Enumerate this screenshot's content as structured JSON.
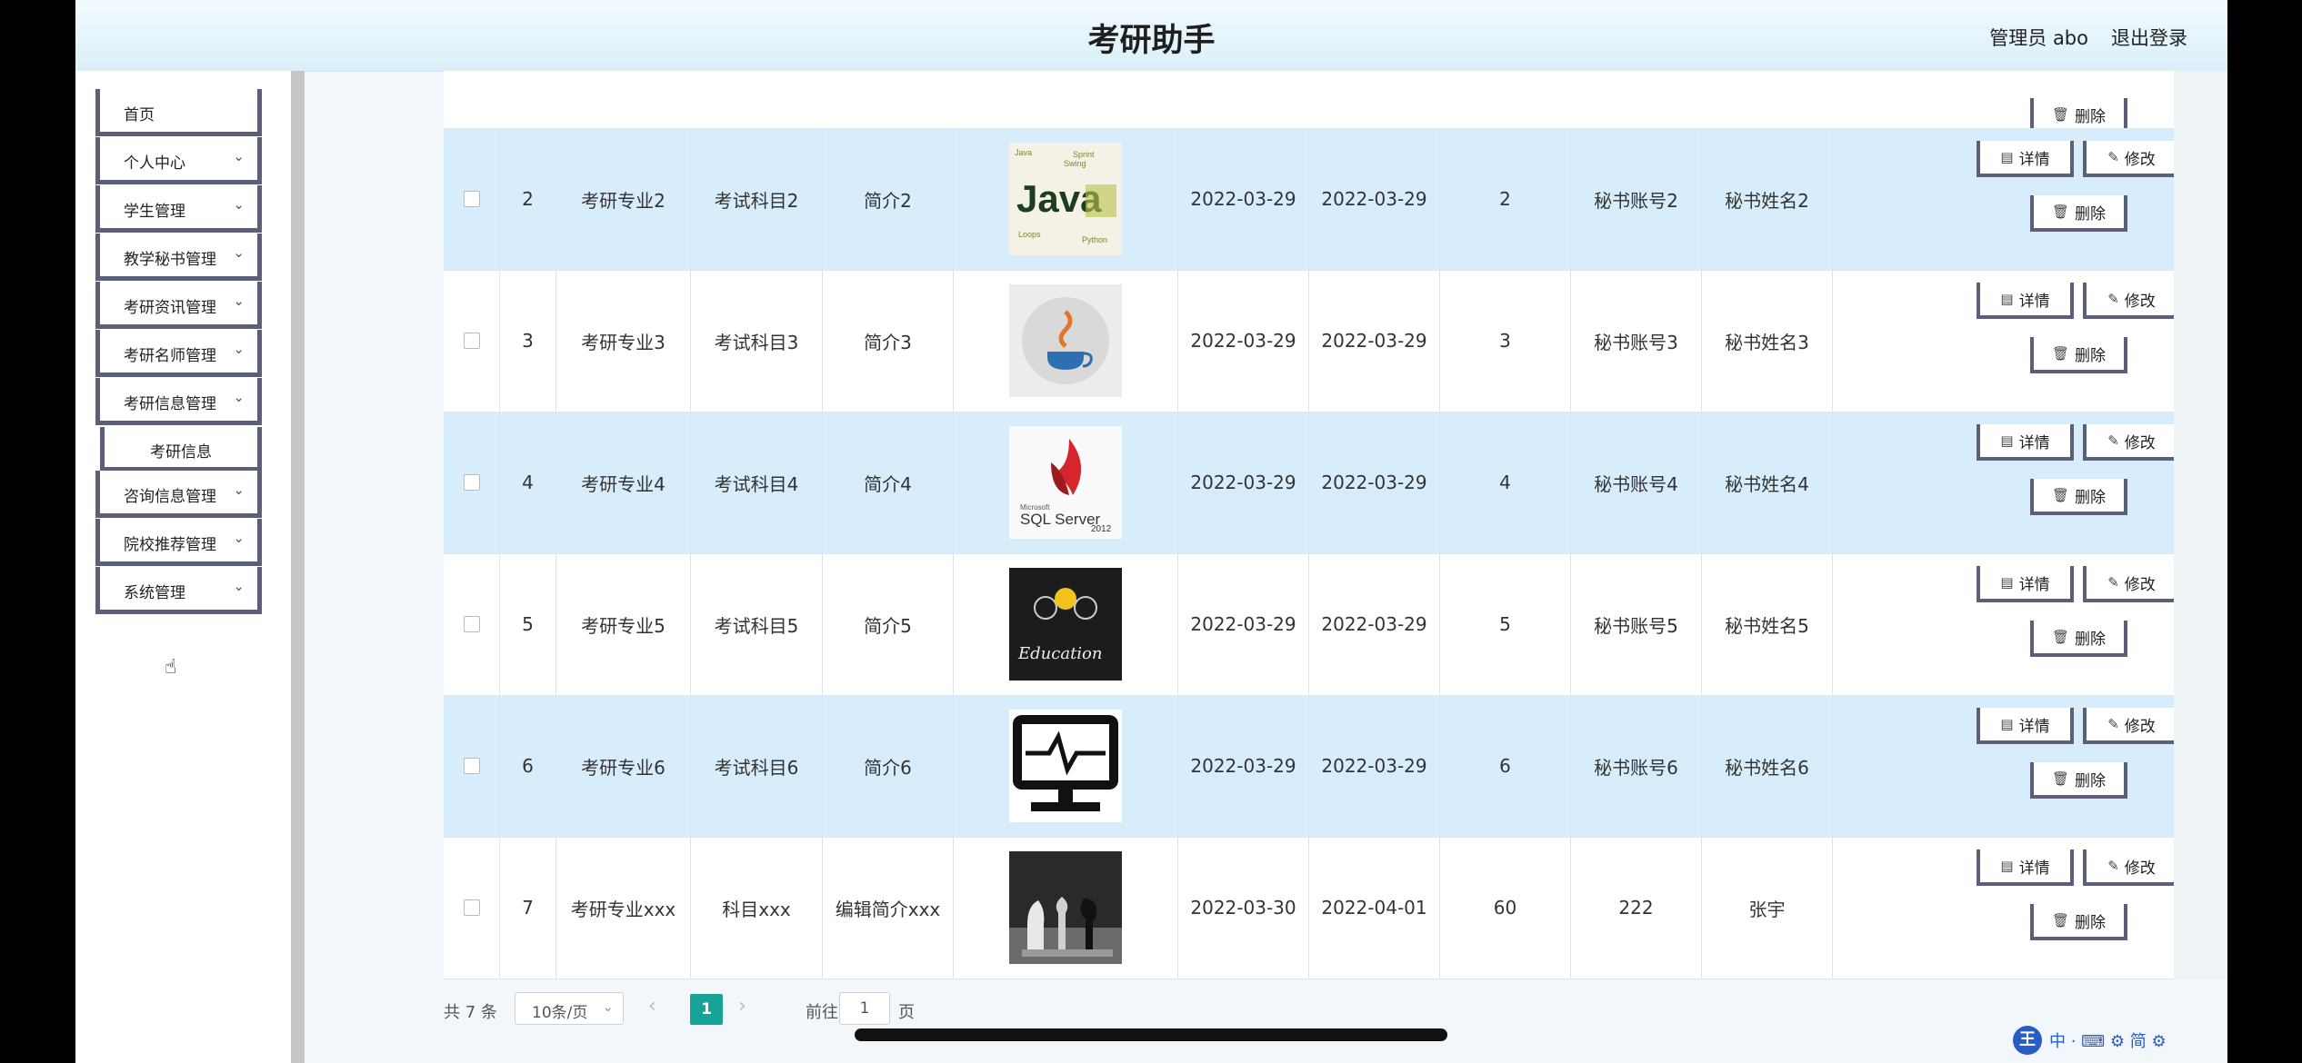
{
  "header": {
    "title": "考研助手",
    "admin": "管理员 abo",
    "logout": "退出登录"
  },
  "sidebar": {
    "items": [
      {
        "label": "首页",
        "chevron": false
      },
      {
        "label": "个人中心",
        "chevron": true
      },
      {
        "label": "学生管理",
        "chevron": true
      },
      {
        "label": "教学秘书管理",
        "chevron": true
      },
      {
        "label": "考研资讯管理",
        "chevron": true
      },
      {
        "label": "考研名师管理",
        "chevron": true
      },
      {
        "label": "考研信息管理",
        "chevron": true
      },
      {
        "label": "咨询信息管理",
        "chevron": true
      },
      {
        "label": "院校推荐管理",
        "chevron": true
      },
      {
        "label": "系统管理",
        "chevron": true
      }
    ],
    "subitem": "考研信息",
    "chevron_glyph": "⌄"
  },
  "actions": {
    "detail": "详情",
    "edit": "修改",
    "delete": "删除"
  },
  "rows": [
    {
      "no": "2",
      "major": "考研专业2",
      "subject": "考试科目2",
      "intro": "简介2",
      "image": "java-logo",
      "date1": "2022-03-29",
      "date2": "2022-03-29",
      "count": "2",
      "account": "秘书账号2",
      "name": "秘书姓名2"
    },
    {
      "no": "3",
      "major": "考研专业3",
      "subject": "考试科目3",
      "intro": "简介3",
      "image": "java-cup-icon",
      "date1": "2022-03-29",
      "date2": "2022-03-29",
      "count": "3",
      "account": "秘书账号3",
      "name": "秘书姓名3"
    },
    {
      "no": "4",
      "major": "考研专业4",
      "subject": "考试科目4",
      "intro": "简介4",
      "image": "sql-server-logo",
      "date1": "2022-03-29",
      "date2": "2022-03-29",
      "count": "4",
      "account": "秘书账号4",
      "name": "秘书姓名4"
    },
    {
      "no": "5",
      "major": "考研专业5",
      "subject": "考试科目5",
      "intro": "简介5",
      "image": "education-chalkboard",
      "date1": "2022-03-29",
      "date2": "2022-03-29",
      "count": "5",
      "account": "秘书账号5",
      "name": "秘书姓名5"
    },
    {
      "no": "6",
      "major": "考研专业6",
      "subject": "考试科目6",
      "intro": "简介6",
      "image": "monitor-heartbeat-icon",
      "date1": "2022-03-29",
      "date2": "2022-03-29",
      "count": "6",
      "account": "秘书账号6",
      "name": "秘书姓名6"
    },
    {
      "no": "7",
      "major": "考研专业xxx",
      "subject": "科目xxx",
      "intro": "编辑简介xxx",
      "image": "chess-pieces",
      "date1": "2022-03-30",
      "date2": "2022-04-01",
      "count": "60",
      "account": "222",
      "name": "张宇"
    }
  ],
  "thumb_text": {
    "java": "Java",
    "sql_top": "Microsoft",
    "sql_main": "SQL Server",
    "sql_year": "2012",
    "edu": "Education"
  },
  "pagination": {
    "total": "共 7 条",
    "page_size": "10条/页",
    "current": "1",
    "goto_label": "前往",
    "goto_value": "1",
    "page_label": "页",
    "prev": "‹",
    "next": "›",
    "caret": "⌄"
  },
  "overlay": {
    "ime_logo": "王",
    "ime_text": "中 · ⌨ ⚙ 简 ⚙"
  },
  "colors": {
    "header_bg": "#d9eff9",
    "row_alt": "#d7edfb",
    "pager_active": "#17a398",
    "button_border": "#5b5f7a"
  }
}
